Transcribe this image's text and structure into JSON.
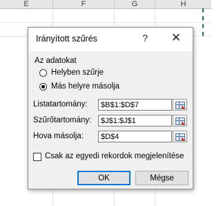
{
  "spreadsheet": {
    "columns": [
      "E",
      "F",
      "G",
      "H"
    ]
  },
  "dialog": {
    "title": "Irányított szűrés",
    "help_glyph": "?",
    "close_glyph": "✕",
    "action_group": {
      "label": "Az adatokat",
      "options": [
        {
          "label": "Helyben szűrje",
          "checked": false
        },
        {
          "label": "Más helyre másolja",
          "checked": true
        }
      ]
    },
    "fields": [
      {
        "label": "Listatartomány:",
        "value": "$B$1:$D$7"
      },
      {
        "label": "Szűrőtartomány:",
        "value": "$J$1:$J$1"
      },
      {
        "label": "Hova másolja:",
        "value": "$D$4"
      }
    ],
    "unique_checkbox": {
      "label": "Csak az egyedi rekordok megjelenítése",
      "checked": false
    },
    "ok_label": "OK",
    "cancel_label": "Mégse",
    "focus_color": "#0078d7"
  }
}
